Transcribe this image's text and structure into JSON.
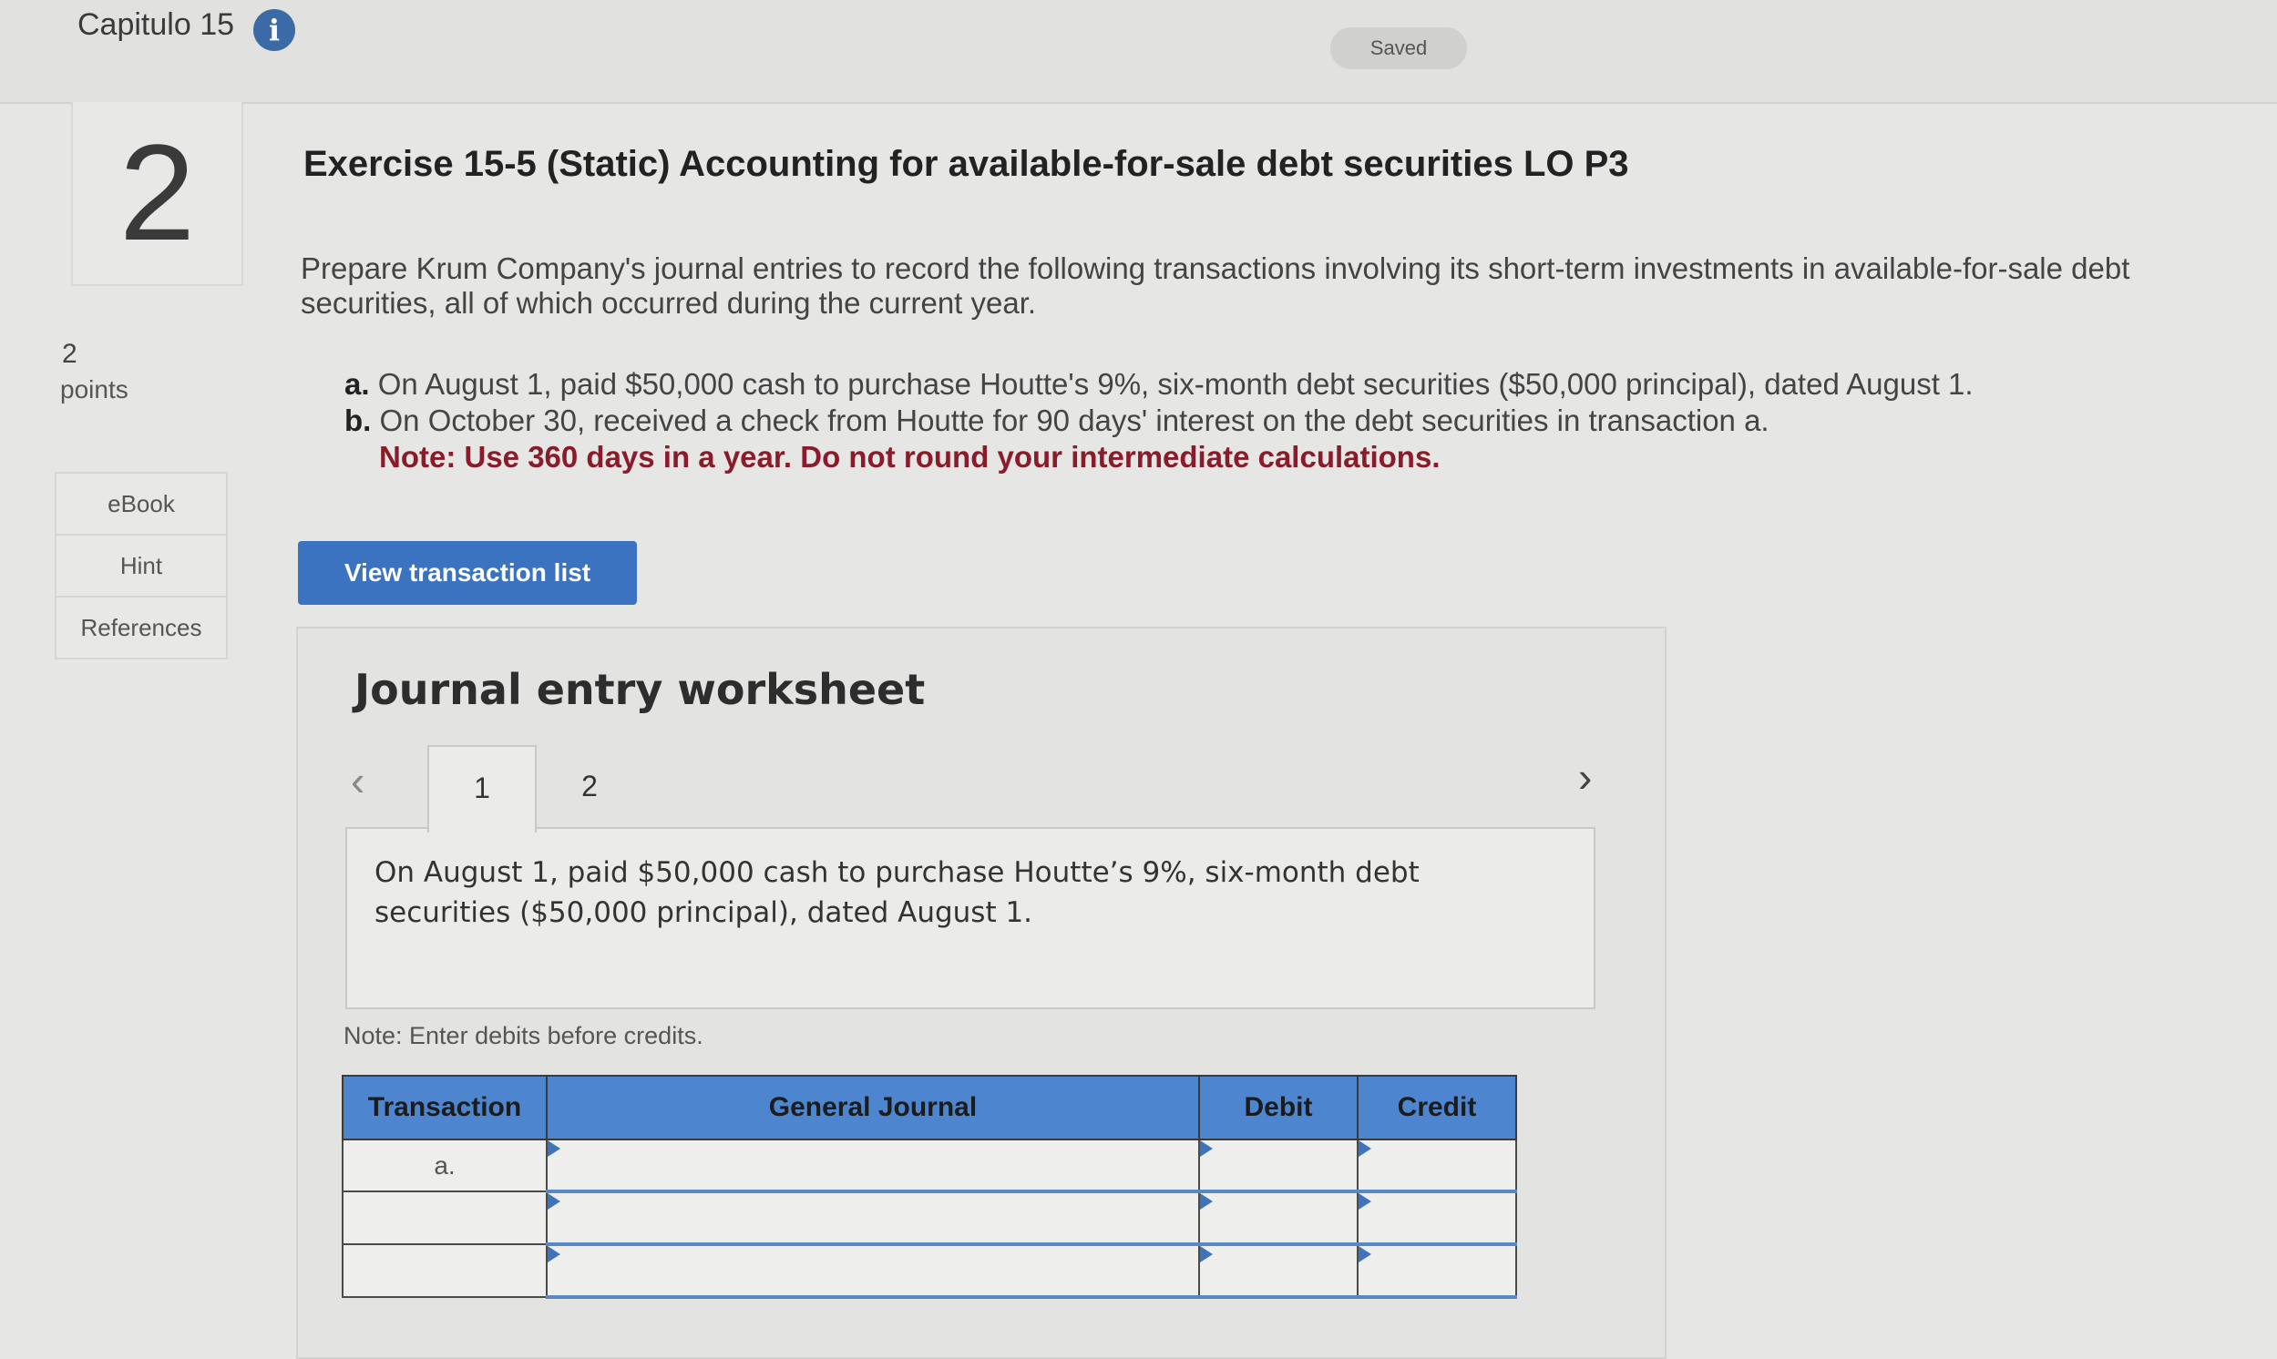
{
  "header": {
    "chapter_title": "Capitulo 15",
    "info_icon": "info-icon",
    "status": "Saved"
  },
  "question": {
    "number": "2",
    "points_value": "2",
    "points_label": "points"
  },
  "side_links": [
    "eBook",
    "Hint",
    "References"
  ],
  "exercise": {
    "title": "Exercise 15-5 (Static) Accounting for available-for-sale debt securities LO P3",
    "prompt": "Prepare Krum Company's journal entries to record the following transactions involving its short-term investments in available-for-sale debt securities, all of which occurred during the current year.",
    "items": [
      {
        "letter": "a.",
        "text": "On August 1, paid $50,000 cash to purchase Houtte's 9%, six-month debt securities ($50,000 principal), dated August 1."
      },
      {
        "letter": "b.",
        "text": "On October 30, received a check from Houtte for 90 days' interest on the debt securities in transaction a."
      }
    ],
    "note": "Note: Use 360 days in a year. Do not round your intermediate calculations."
  },
  "view_button": "View transaction list",
  "worksheet": {
    "title": "Journal entry worksheet",
    "tabs": [
      "1",
      "2"
    ],
    "prev_icon": "chevron-left-icon",
    "next_icon": "chevron-right-icon",
    "description": "On August 1, paid $50,000 cash to purchase Houtte’s 9%, six-month debt securities ($50,000 principal), dated August 1.",
    "note": "Note: Enter debits before credits.",
    "columns": [
      "Transaction",
      "General Journal",
      "Debit",
      "Credit"
    ],
    "rows": [
      {
        "transaction": "a.",
        "account": "",
        "debit": "",
        "credit": ""
      },
      {
        "transaction": "",
        "account": "",
        "debit": "",
        "credit": ""
      },
      {
        "transaction": "",
        "account": "",
        "debit": "",
        "credit": ""
      }
    ]
  }
}
